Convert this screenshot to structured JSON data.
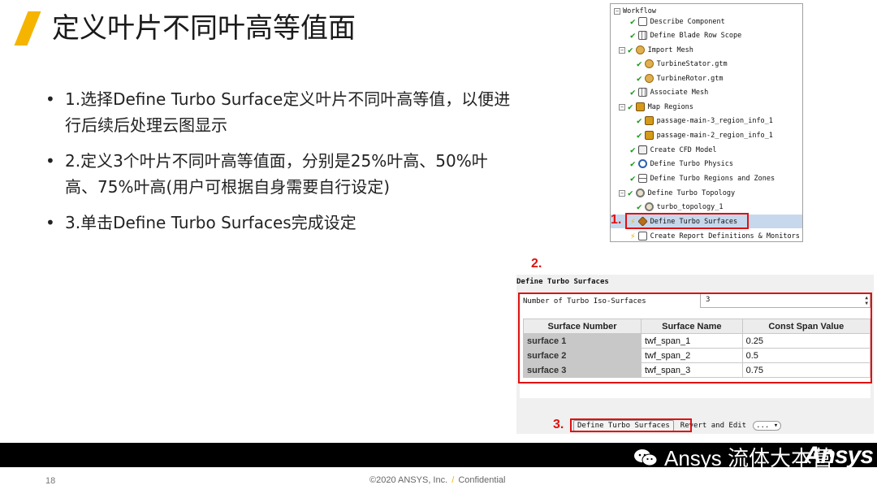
{
  "slide": {
    "title": "定义叶片不同叶高等值面",
    "bullets": [
      "1.选择Define Turbo Surface定义叶片不同叶高等值，以便进行后续后处理云图显示",
      "2.定义3个叶片不同叶高等值面，分别是25%叶高、50%叶高、75%叶高(用户可根据自身需要自行设定)",
      "3.单击Define Turbo Surfaces完成设定"
    ],
    "accent_color": "#f5b400"
  },
  "workflow": {
    "header": "Workflow",
    "items": [
      {
        "label": "Describe Component",
        "icon": "document-icon",
        "status": "done"
      },
      {
        "label": "Define Blade Row Scope",
        "icon": "grid-icon",
        "status": "done"
      },
      {
        "label": "Import Mesh",
        "icon": "mesh-icon",
        "status": "done"
      },
      {
        "label": "TurbineStator.gtm",
        "icon": "mesh-icon",
        "status": "done"
      },
      {
        "label": "TurbineRotor.gtm",
        "icon": "mesh-icon",
        "status": "done"
      },
      {
        "label": "Associate Mesh",
        "icon": "grid-icon",
        "status": "done"
      },
      {
        "label": "Map Regions",
        "icon": "map-icon",
        "status": "done"
      },
      {
        "label": "passage-main-3_region_info_1",
        "icon": "map-icon",
        "status": "done"
      },
      {
        "label": "passage-main-2_region_info_1",
        "icon": "map-icon",
        "status": "done"
      },
      {
        "label": "Create CFD Model",
        "icon": "cfd-icon",
        "status": "done"
      },
      {
        "label": "Define Turbo Physics",
        "icon": "physics-icon",
        "status": "done"
      },
      {
        "label": "Define Turbo Regions and Zones",
        "icon": "zones-icon",
        "status": "done"
      },
      {
        "label": "Define Turbo Topology",
        "icon": "topology-icon",
        "status": "done"
      },
      {
        "label": "turbo_topology_1",
        "icon": "topology-icon",
        "status": "done"
      },
      {
        "label": "Define Turbo Surfaces",
        "icon": "surface-icon",
        "status": "pending"
      },
      {
        "label": "Create Report Definitions & Monitors",
        "icon": "report-icon",
        "status": "pending"
      }
    ]
  },
  "annotations": {
    "step1": "1.",
    "step2": "2.",
    "step3": "3."
  },
  "turbo_surfaces": {
    "title": "Define Turbo Surfaces",
    "iso_label": "Number of Turbo Iso-Surfaces",
    "iso_value": "3",
    "columns": [
      "Surface Number",
      "Surface Name",
      "Const Span Value"
    ],
    "rows": [
      [
        "surface 1",
        "twf_span_1",
        "0.25"
      ],
      [
        "surface 2",
        "twf_span_2",
        "0.5"
      ],
      [
        "surface 3",
        "twf_span_3",
        "0.75"
      ]
    ],
    "buttons": {
      "define": "Define Turbo Surfaces",
      "revert": "Revert and Edit",
      "more": "..."
    }
  },
  "footer": {
    "brand_text": "Ansys 流体大本营",
    "logo": "Ansys",
    "page_number": "18",
    "copyright_left": "©2020 ANSYS, Inc.",
    "copyright_sep": "/",
    "copyright_right": "Confidential"
  }
}
